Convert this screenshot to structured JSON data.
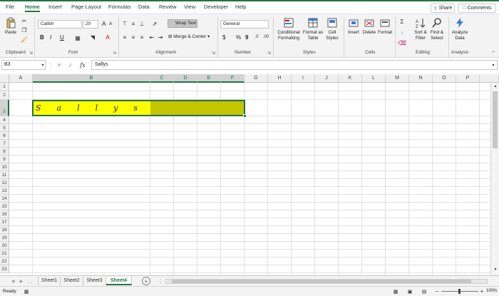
{
  "menu": {
    "tabs": [
      "File",
      "Home",
      "Insert",
      "Page Layout",
      "Formulas",
      "Data",
      "Review",
      "View",
      "Developer",
      "Help"
    ],
    "share_label": "Share",
    "comments_label": "Comments"
  },
  "ribbon": {
    "clipboard": {
      "paste_label": "Paste",
      "group_label": "Clipboard"
    },
    "font": {
      "name": "Calibri",
      "size": "20",
      "group_label": "Font",
      "bold": "B",
      "italic": "I",
      "underline": "U",
      "grow": "A",
      "shrink": "A"
    },
    "alignment": {
      "wrap_label": "Wrap Text",
      "merge_label": "Merge & Center",
      "group_label": "Alignment"
    },
    "number": {
      "format": "General",
      "currency": "$",
      "percent": "%",
      "comma": "9",
      "group_label": "Number"
    },
    "styles": {
      "conditional_label": "Conditional Formatting",
      "format_table_label": "Format as Table",
      "cell_styles_label": "Cell Styles",
      "group_label": "Styles"
    },
    "cells": {
      "insert_label": "Insert",
      "delete_label": "Delete",
      "format_label": "Format",
      "group_label": "Cells"
    },
    "editing": {
      "sort_label": "Sort & Filter",
      "find_label": "Find & Select",
      "group_label": "Editing"
    },
    "analysis": {
      "analyze_label": "Analyze Data",
      "group_label": "Analysis"
    }
  },
  "formula_bar": {
    "name_box": "B3",
    "fx": "fx",
    "value": "Sallys"
  },
  "sheet": {
    "columns": [
      "A",
      "B",
      "C",
      "D",
      "E",
      "F",
      "G",
      "H",
      "I",
      "J",
      "K",
      "L",
      "M",
      "N",
      "O",
      "P"
    ],
    "rows": [
      "1",
      "2",
      "3",
      "4",
      "5",
      "6",
      "7",
      "8",
      "9",
      "10",
      "11",
      "12",
      "13",
      "14",
      "15",
      "16",
      "17",
      "18",
      "19",
      "20",
      "21",
      "22",
      "23"
    ],
    "signature_glyphs": [
      "S",
      "a",
      "l",
      "l",
      "y",
      "s"
    ],
    "cell_b3_color": "#ffff00",
    "cell_c3_f3_color": "#c5c500"
  },
  "sheet_tabs": [
    "Sheet1",
    "Sheet2",
    "Sheet3",
    "Sheet4"
  ],
  "active_sheet": "Sheet4",
  "status": {
    "ready": "Ready",
    "zoom": "100%"
  },
  "colors": {
    "accent": "#217346"
  }
}
